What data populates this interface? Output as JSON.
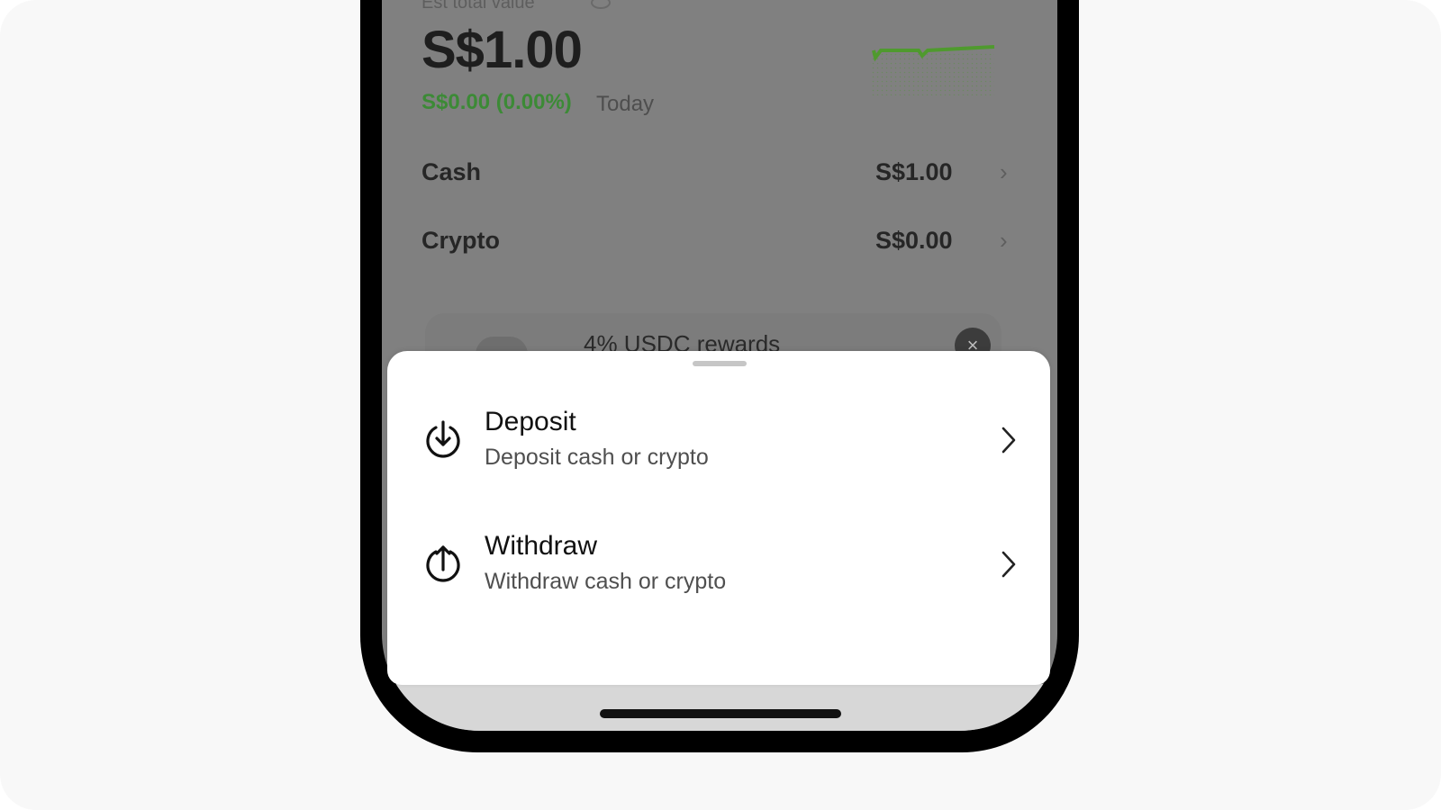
{
  "portfolio": {
    "est_label": "Est total value",
    "total_value": "S$1.00",
    "change": "S$0.00 (0.00%)",
    "change_period": "Today",
    "rows": [
      {
        "label": "Cash",
        "value": "S$1.00"
      },
      {
        "label": "Crypto",
        "value": "S$0.00"
      }
    ],
    "banner": {
      "text": "4% USDC rewards"
    }
  },
  "sheet": {
    "options": [
      {
        "title": "Deposit",
        "subtitle": "Deposit cash or crypto",
        "icon": "deposit-arrow-down-icon"
      },
      {
        "title": "Withdraw",
        "subtitle": "Withdraw cash or crypto",
        "icon": "withdraw-arrow-up-icon"
      }
    ]
  },
  "colors": {
    "accent_green": "#3c8a36",
    "sparkline_green": "#63c33a",
    "overlay_gray": "#808080",
    "sheet_bg": "#ffffff",
    "text_primary": "#111111",
    "text_secondary": "#4f4f4f"
  }
}
